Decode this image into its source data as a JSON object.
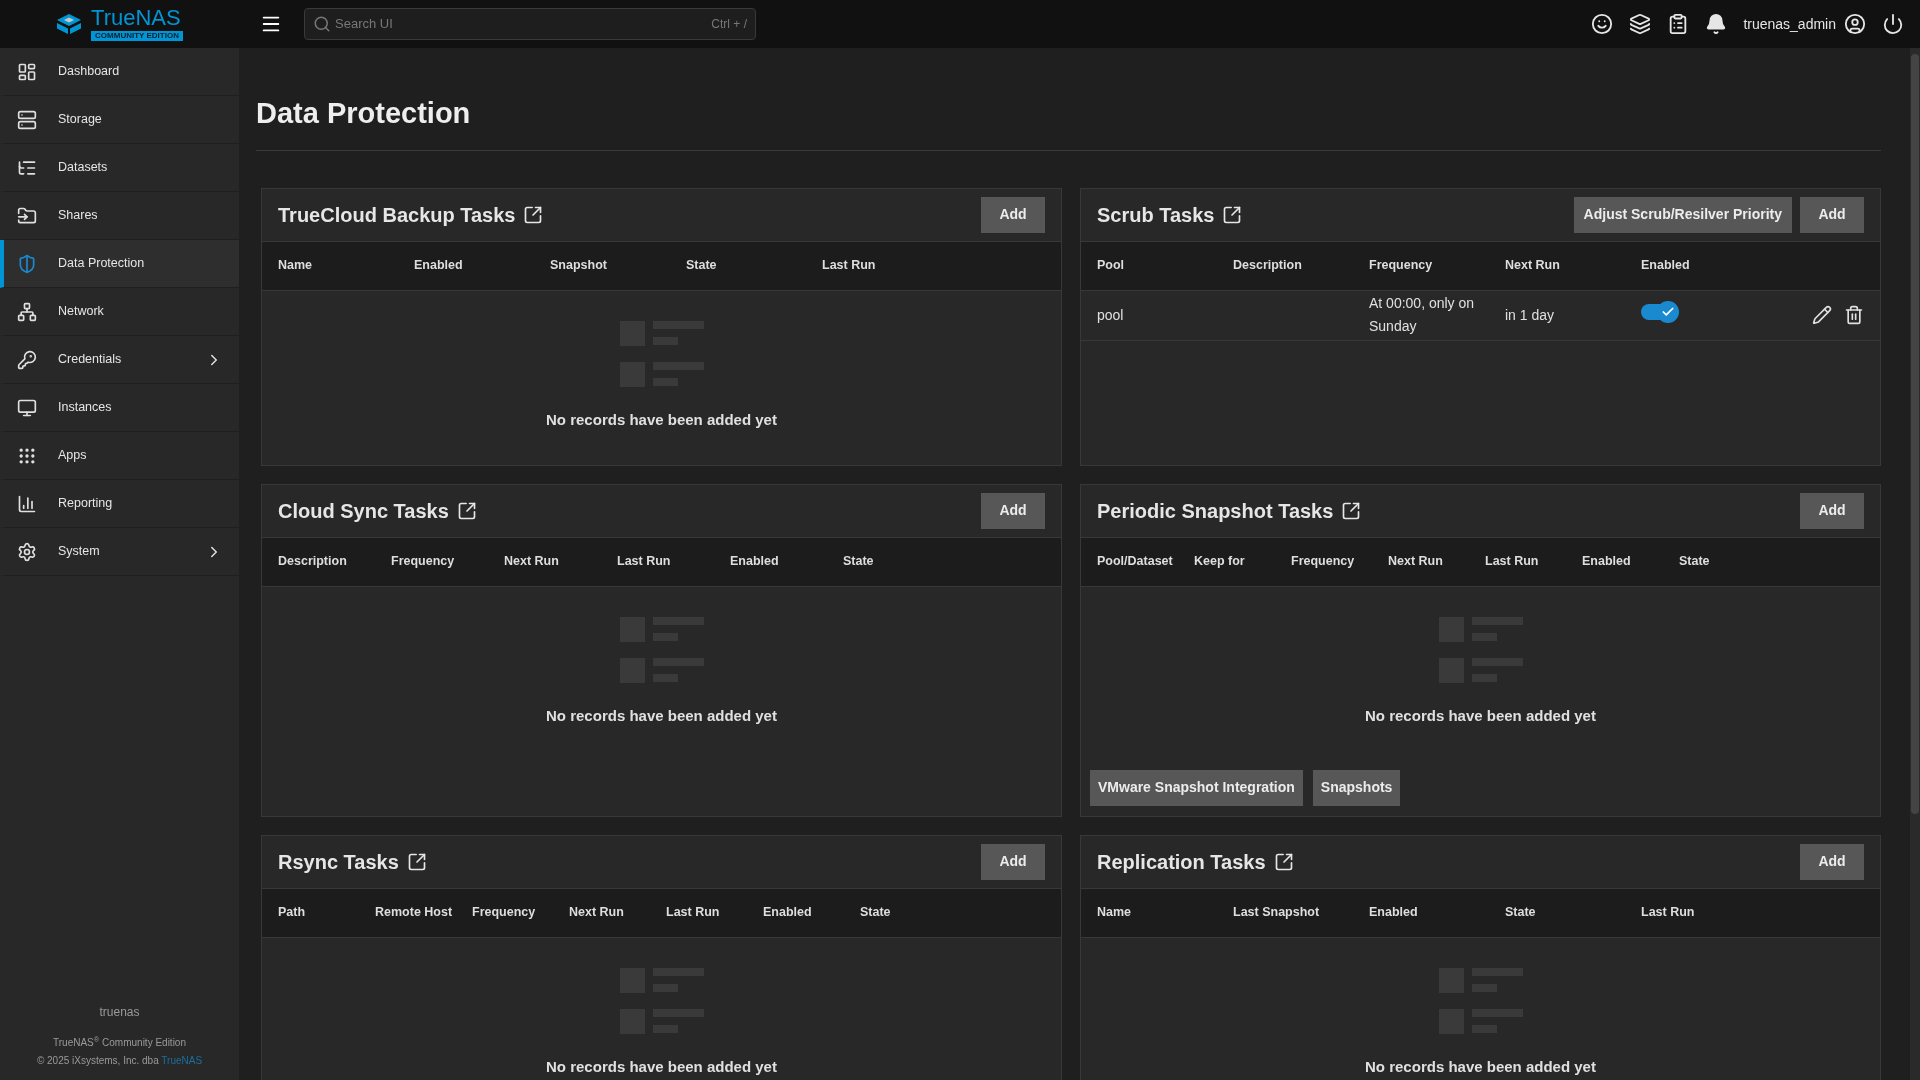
{
  "topbar": {
    "logo": {
      "name": "TrueNAS",
      "edition": "COMMUNITY EDITION"
    },
    "search": {
      "placeholder": "Search UI",
      "shortcut": "Ctrl + /"
    },
    "username": "truenas_admin"
  },
  "sidebar": {
    "items": [
      {
        "label": "Dashboard",
        "selected": false,
        "has_submenu": false
      },
      {
        "label": "Storage",
        "selected": false,
        "has_submenu": false
      },
      {
        "label": "Datasets",
        "selected": false,
        "has_submenu": false
      },
      {
        "label": "Shares",
        "selected": false,
        "has_submenu": false
      },
      {
        "label": "Data Protection",
        "selected": true,
        "has_submenu": false
      },
      {
        "label": "Network",
        "selected": false,
        "has_submenu": false
      },
      {
        "label": "Credentials",
        "selected": false,
        "has_submenu": true
      },
      {
        "label": "Instances",
        "selected": false,
        "has_submenu": false
      },
      {
        "label": "Apps",
        "selected": false,
        "has_submenu": false
      },
      {
        "label": "Reporting",
        "selected": false,
        "has_submenu": false
      },
      {
        "label": "System",
        "selected": false,
        "has_submenu": true
      }
    ],
    "footer": {
      "hostname": "truenas",
      "product": "TrueNAS$^{®}$ Community Edition",
      "copyright": "© 2025 iXsystems, Inc. dba",
      "copyright_link": "TrueNAS"
    }
  },
  "page": {
    "title": "Data Protection"
  },
  "cards": [
    {
      "title": "TrueCloud Backup Tasks",
      "buttons": [
        "Add"
      ],
      "columns": [
        "Name",
        "Enabled",
        "Snapshot",
        "State",
        "Last Run"
      ],
      "empty_text": "No records have been added yet"
    },
    {
      "title": "Scrub Tasks",
      "buttons": [
        "Adjust Scrub/Resilver Priority",
        "Add"
      ],
      "columns": [
        "Pool",
        "Description",
        "Frequency",
        "Next Run",
        "Enabled"
      ],
      "rows": [
        {
          "pool": "pool",
          "frequency": "At 00:00, only on Sunday",
          "next_run": "in 1 day",
          "enabled": true
        }
      ]
    },
    {
      "title": "Cloud Sync Tasks",
      "buttons": [
        "Add"
      ],
      "columns": [
        "Description",
        "Frequency",
        "Next Run",
        "Last Run",
        "Enabled",
        "State"
      ],
      "empty_text": "No records have been added yet"
    },
    {
      "title": "Periodic Snapshot Tasks",
      "buttons": [
        "Add"
      ],
      "columns": [
        "Pool/Dataset",
        "Keep for",
        "Frequency",
        "Next Run",
        "Last Run",
        "Enabled",
        "State"
      ],
      "empty_text": "No records have been added yet",
      "footer_buttons": [
        "VMware Snapshot Integration",
        "Snapshots"
      ]
    },
    {
      "title": "Rsync Tasks",
      "buttons": [
        "Add"
      ],
      "columns": [
        "Path",
        "Remote Host",
        "Frequency",
        "Next Run",
        "Last Run",
        "Enabled",
        "State"
      ],
      "empty_text": "No records have been added yet"
    },
    {
      "title": "Replication Tasks",
      "buttons": [
        "Add"
      ],
      "columns": [
        "Name",
        "Last Snapshot",
        "Enabled",
        "State",
        "Last Run"
      ],
      "empty_text": "No records have been added yet"
    }
  ]
}
